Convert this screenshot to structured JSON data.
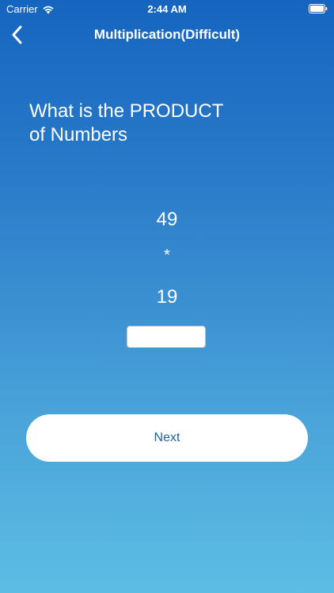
{
  "status_bar": {
    "carrier": "Carrier",
    "time": "2:44 AM",
    "wifi_icon": "wifi-icon",
    "battery_icon": "battery-icon"
  },
  "nav": {
    "title": "Multiplication(Difficult)",
    "back_icon": "chevron-left-icon"
  },
  "question": {
    "line1": "What is the PRODUCT",
    "line2": "of Numbers"
  },
  "problem": {
    "first": "49",
    "operator": "*",
    "second": "19"
  },
  "answer": {
    "value": "",
    "placeholder": ""
  },
  "actions": {
    "next_label": "Next"
  },
  "colors": {
    "gradient_top": "#1565c0",
    "gradient_bottom": "#5dbde3",
    "button_text": "#1f5f9e"
  }
}
